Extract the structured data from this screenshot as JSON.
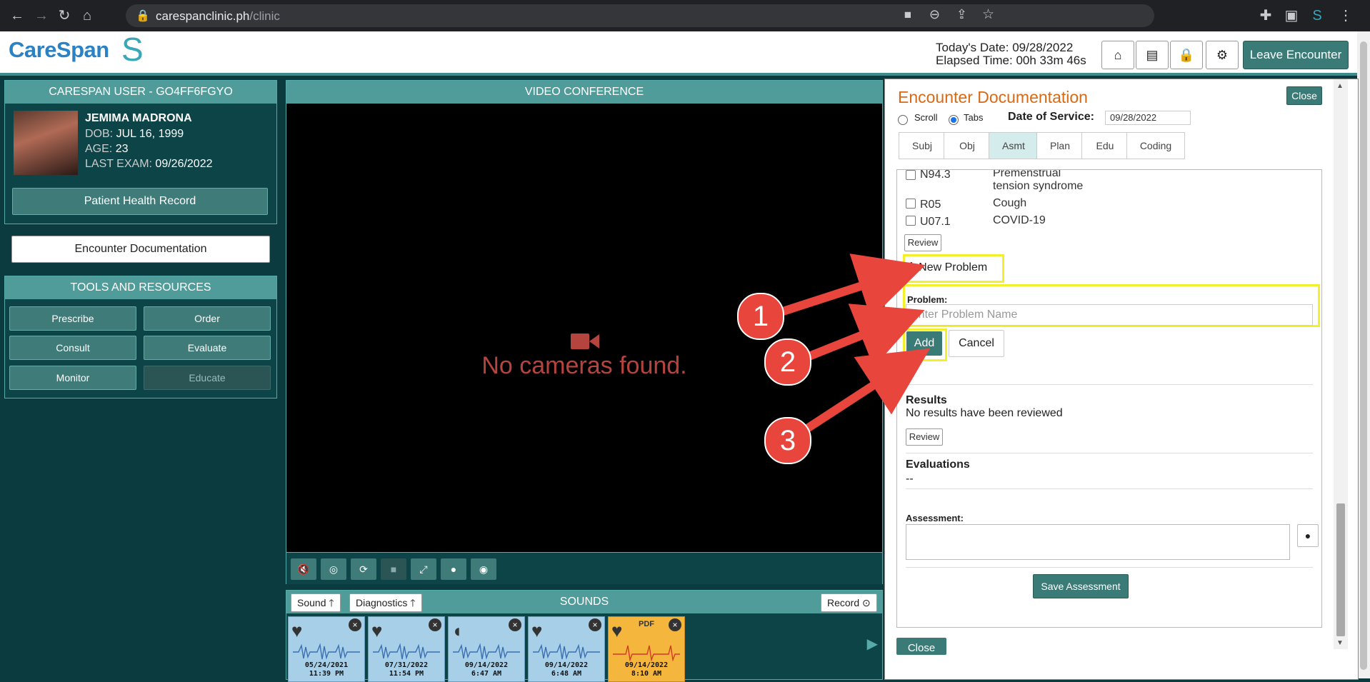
{
  "browser": {
    "url_domain": "carespanclinic.ph",
    "url_path": "/clinic"
  },
  "header": {
    "logo_text": "CareSpan",
    "todays_date_label": "Today's Date: 09/28/2022",
    "elapsed_time_label": "Elapsed Time: 00h 33m 46s",
    "leave_label": "Leave Encounter"
  },
  "patient_panel": {
    "title": "CARESPAN USER - GO4FF6FGYO",
    "name": "JEMIMA MADRONA",
    "dob_label": "DOB:",
    "dob": "JUL 16, 1999",
    "age_label": "AGE:",
    "age": "23",
    "last_exam_label": "LAST EXAM:",
    "last_exam": "09/26/2022",
    "phr_label": "Patient Health Record"
  },
  "encounter_doc_button": "Encounter Documentation",
  "tools": {
    "title": "TOOLS AND RESOURCES",
    "buttons": [
      "Prescribe",
      "Order",
      "Consult",
      "Evaluate",
      "Monitor",
      "Educate"
    ]
  },
  "video": {
    "title": "VIDEO CONFERENCE",
    "message": "No cameras found."
  },
  "sounds": {
    "title": "SOUNDS",
    "sound_label": "Sound",
    "diagnostics_label": "Diagnostics",
    "record_label": "Record",
    "tiles": [
      {
        "date": "05/24/2021",
        "time": "11:39 PM",
        "kind": "heart-icon"
      },
      {
        "date": "07/31/2022",
        "time": "11:54 PM",
        "kind": "heart-icon"
      },
      {
        "date": "09/14/2022",
        "time": "6:47 AM",
        "kind": "ear-icon"
      },
      {
        "date": "09/14/2022",
        "time": "6:48 AM",
        "kind": "heart-icon"
      },
      {
        "date": "09/14/2022",
        "time": "8:10 AM",
        "kind": "heart-icon",
        "badge": "PDF"
      }
    ]
  },
  "encounter": {
    "title": "Encounter Documentation",
    "close_label": "Close",
    "scroll_label": "Scroll",
    "tabs_label": "Tabs",
    "dos_label": "Date of Service:",
    "dos_value": "09/28/2022",
    "tabs": [
      "Subj",
      "Obj",
      "Asmt",
      "Plan",
      "Edu",
      "Coding"
    ],
    "active_tab": "Asmt",
    "problems": [
      {
        "code": "N94.3",
        "desc_line1": "Premenstrual",
        "desc_line2": "tension syndrome"
      },
      {
        "code": "R05",
        "desc_line1": "Cough",
        "desc_line2": ""
      },
      {
        "code": "U07.1",
        "desc_line1": "COVID-19",
        "desc_line2": ""
      }
    ],
    "review_label": "Review",
    "new_problem_label": "New Problem",
    "problem_label": "Problem:",
    "problem_placeholder": "Enter Problem Name",
    "add_label": "Add",
    "cancel_label": "Cancel",
    "results_title": "Results",
    "results_text": "No results have been reviewed",
    "evaluations_title": "Evaluations",
    "evaluations_text": "--",
    "assessment_label": "Assessment:",
    "save_assessment_label": "Save Assessment",
    "close_bottom_label": "Close"
  },
  "annotations": [
    "1",
    "2",
    "3"
  ],
  "colors": {
    "accent_teal": "#3a7b78",
    "annotation_red": "#e8453c",
    "highlight_yellow": "#f2f02a",
    "title_orange": "#d86a16"
  }
}
